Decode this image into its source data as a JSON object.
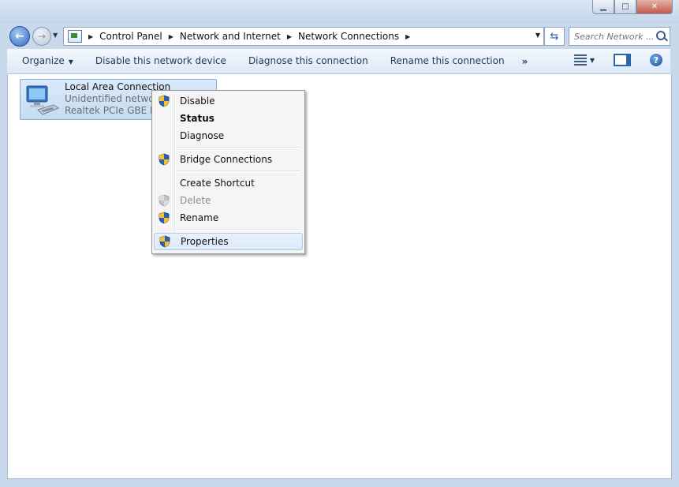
{
  "window": {
    "controls": {
      "minimize": "▁",
      "maximize": "□",
      "close": "✕"
    }
  },
  "address_bar": {
    "crumbs": [
      "Control Panel",
      "Network and Internet",
      "Network Connections"
    ],
    "search_placeholder": "Search Network ..."
  },
  "toolbar": {
    "organize": "Organize",
    "disable": "Disable this network device",
    "diagnose": "Diagnose this connection",
    "rename": "Rename this connection",
    "more": "»",
    "help": "?"
  },
  "connection": {
    "name": "Local Area Connection",
    "status": "Unidentified network",
    "device": "Realtek PCIe GBE Fam"
  },
  "context_menu": {
    "items": [
      {
        "label": "Disable",
        "icon": "uac-shield-icon"
      },
      {
        "label": "Status",
        "bold": true
      },
      {
        "label": "Diagnose"
      },
      {
        "label": "Bridge Connections",
        "icon": "uac-shield-icon"
      },
      {
        "label": "Create Shortcut"
      },
      {
        "label": "Delete",
        "icon": "uac-shield-icon",
        "disabled": true
      },
      {
        "label": "Rename",
        "icon": "uac-shield-icon"
      },
      {
        "label": "Properties",
        "icon": "uac-shield-icon",
        "highlighted": true
      }
    ]
  }
}
